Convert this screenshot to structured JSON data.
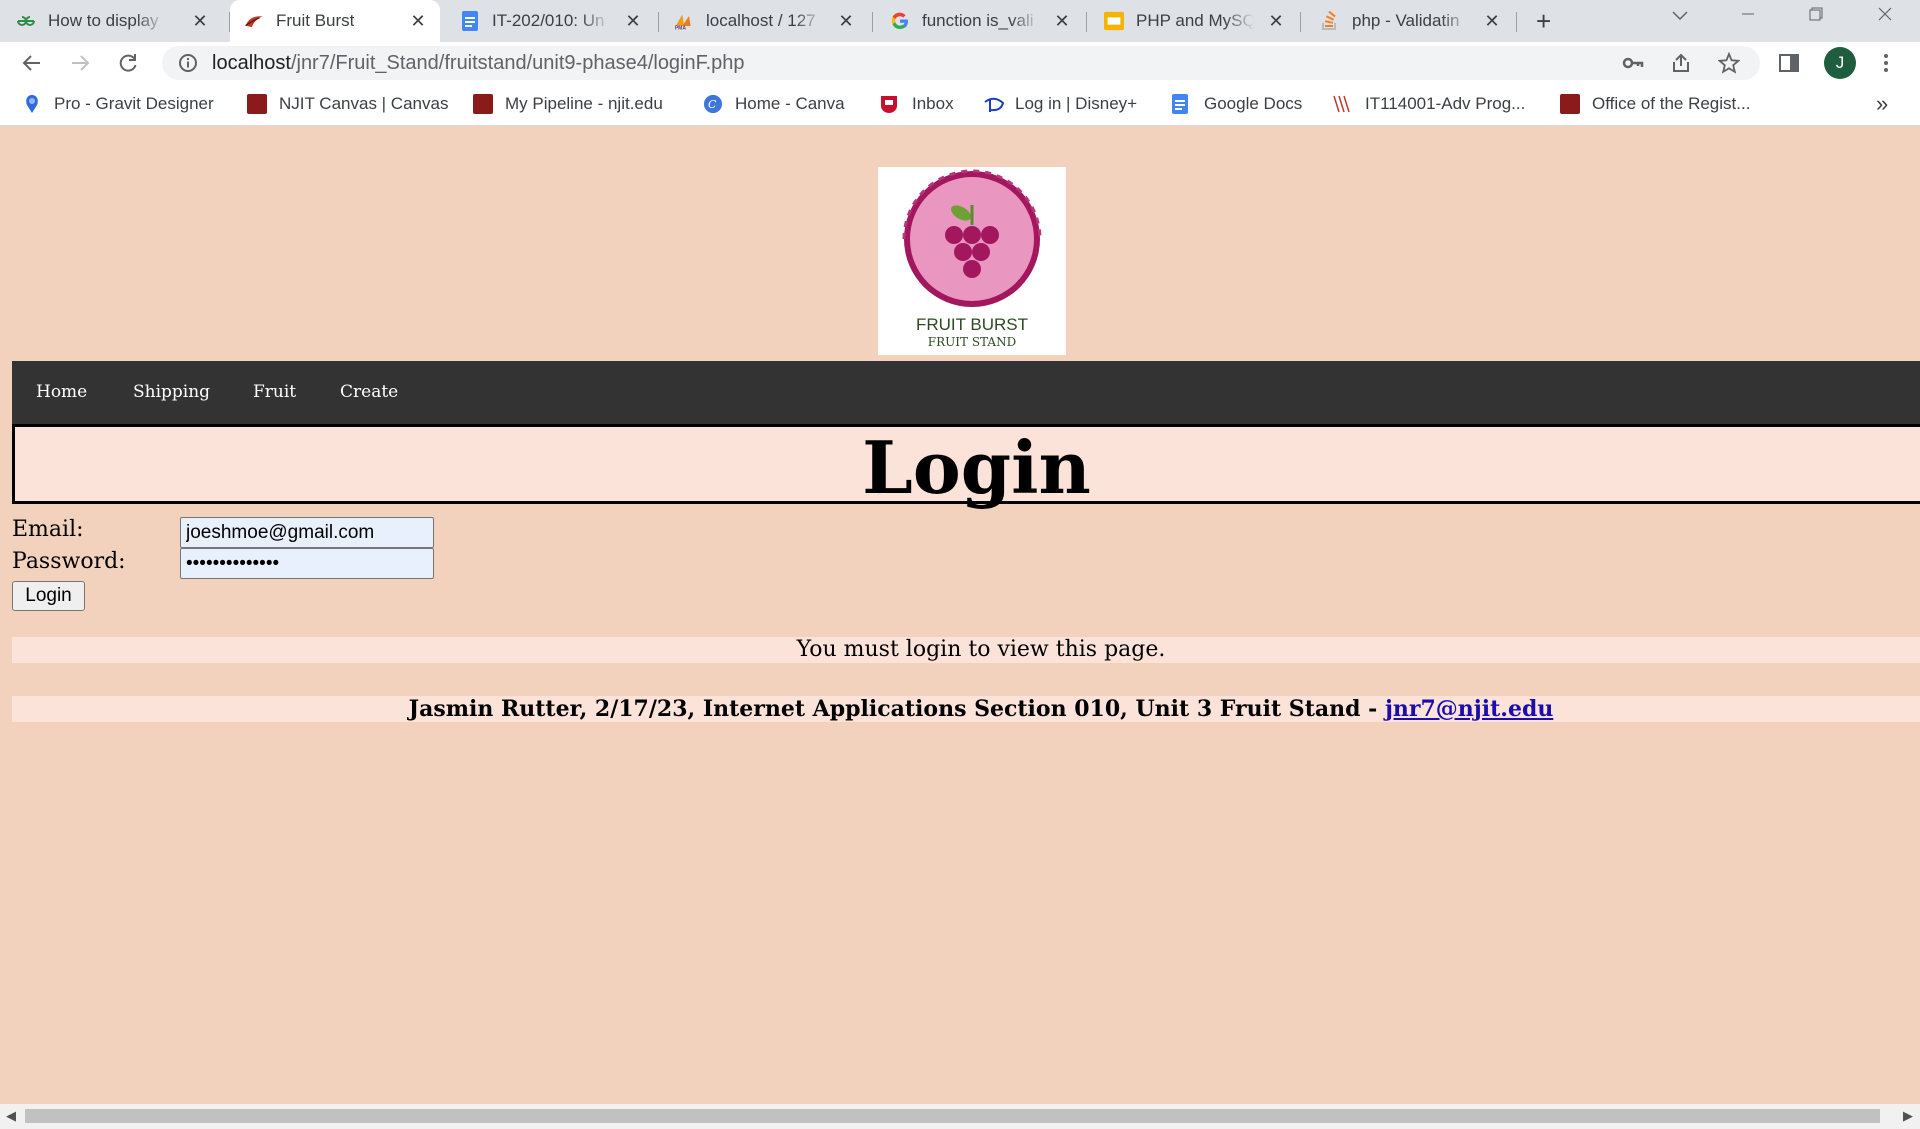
{
  "browser": {
    "tabs": [
      {
        "title": "How to display",
        "icon": "geeksforgeeks-icon",
        "active": false
      },
      {
        "title": "Fruit Burst",
        "icon": "fruit-burst-icon",
        "active": true
      },
      {
        "title": "IT-202/010: Un",
        "icon": "google-docs-icon",
        "active": false
      },
      {
        "title": "localhost / 127",
        "icon": "phpmyadmin-icon",
        "active": false
      },
      {
        "title": "function is_vali",
        "icon": "google-icon",
        "active": false
      },
      {
        "title": "PHP and MySQ",
        "icon": "google-slides-icon",
        "active": false
      },
      {
        "title": "php - Validatin",
        "icon": "stackoverflow-icon",
        "active": false
      }
    ],
    "url_host": "localhost",
    "url_path": "/jnr7/Fruit_Stand/fruitstand/unit9-phase4/loginF.php",
    "profile_initial": "J",
    "bookmarks": [
      {
        "label": "Pro - Gravit Designer",
        "icon": "gravit-icon"
      },
      {
        "label": "NJIT Canvas | Canvas",
        "icon": "njit-icon"
      },
      {
        "label": "My Pipeline - njit.edu",
        "icon": "njit-icon"
      },
      {
        "label": "Home - Canva",
        "icon": "canva-icon"
      },
      {
        "label": "Inbox",
        "icon": "inbox-icon"
      },
      {
        "label": "Log in | Disney+",
        "icon": "disney-icon"
      },
      {
        "label": "Google Docs",
        "icon": "google-docs-icon"
      },
      {
        "label": "IT114001-Adv Prog...",
        "icon": "njit-icon"
      },
      {
        "label": "Office of the Regist...",
        "icon": "njit-icon"
      }
    ],
    "overflow_label": "»"
  },
  "page": {
    "logo": {
      "line1": "FRUIT BURST",
      "line2": "FRUIT STAND"
    },
    "nav": [
      "Home",
      "Shipping",
      "Fruit",
      "Create"
    ],
    "heading": "Login",
    "email_label": "Email:",
    "email_value": "joeshmoe@gmail.com",
    "password_label": "Password:",
    "password_value": "password123456",
    "login_button": "Login",
    "message": "You must login to view this page.",
    "footer_text": "Jasmin Rutter, 2/17/23, Internet Applications Section 010, Unit 3 Fruit Stand - ",
    "footer_link": "jnr7@njit.edu"
  },
  "colors": {
    "page_bg": "#f3d2bd",
    "nav_bg": "#333333",
    "panel_bg": "#fbe3da",
    "logo_pink": "#e996c0",
    "logo_grape": "#a3175f"
  }
}
